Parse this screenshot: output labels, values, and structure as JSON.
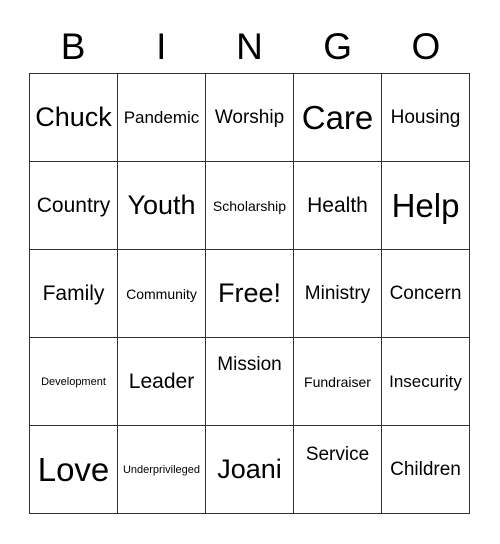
{
  "card": {
    "header": [
      "B",
      "I",
      "N",
      "G",
      "O"
    ],
    "rows": [
      [
        "Chuck",
        "Pandemic",
        "Worship",
        "Care",
        "Housing"
      ],
      [
        "Country",
        "Youth",
        "Scholarship",
        "Health",
        "Help"
      ],
      [
        "Family",
        "Community",
        "Free!",
        "Ministry",
        "Concern"
      ],
      [
        "Development",
        "Leader",
        "Mission",
        "Fundraiser",
        "Insecurity"
      ],
      [
        "Love",
        "Underprivileged",
        "Joani",
        "Service",
        "Children"
      ]
    ]
  }
}
